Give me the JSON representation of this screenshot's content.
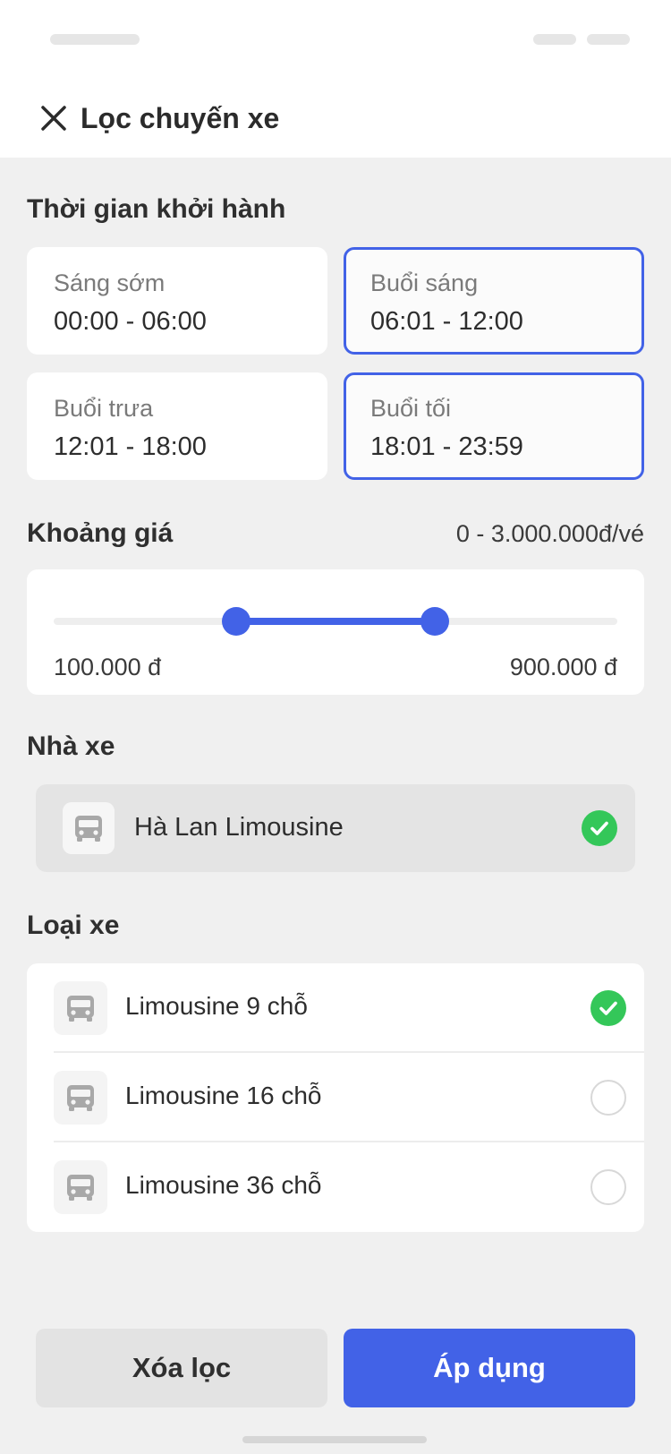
{
  "header": {
    "title": "Lọc chuyến xe",
    "close_icon": "close-icon"
  },
  "departure": {
    "title": "Thời gian khởi hành",
    "slots": [
      {
        "label": "Sáng sớm",
        "range": "00:00 - 06:00",
        "selected": false
      },
      {
        "label": "Buổi sáng",
        "range": "06:01 - 12:00",
        "selected": true
      },
      {
        "label": "Buổi trưa",
        "range": "12:01 - 18:00",
        "selected": false
      },
      {
        "label": "Buổi tối",
        "range": "18:01 - 23:59",
        "selected": true
      }
    ]
  },
  "price": {
    "title": "Khoảng giá",
    "range_text": "0 - 3.000.000đ/vé",
    "min_label": "100.000 đ",
    "max_label": "900.000 đ"
  },
  "operator": {
    "title": "Nhà xe",
    "items": [
      {
        "label": "Hà Lan Limousine",
        "selected": true,
        "icon": "bus-icon"
      }
    ]
  },
  "vehicle_type": {
    "title": "Loại xe",
    "items": [
      {
        "label": "Limousine 9 chỗ",
        "selected": true,
        "icon": "bus-icon"
      },
      {
        "label": "Limousine 16 chỗ",
        "selected": false,
        "icon": "bus-icon"
      },
      {
        "label": "Limousine 36 chỗ",
        "selected": false,
        "icon": "bus-icon"
      }
    ]
  },
  "actions": {
    "clear_label": "Xóa lọc",
    "apply_label": "Áp dụng"
  },
  "colors": {
    "accent": "#4262e7",
    "check": "#34c759",
    "background": "#f0f0f0"
  }
}
